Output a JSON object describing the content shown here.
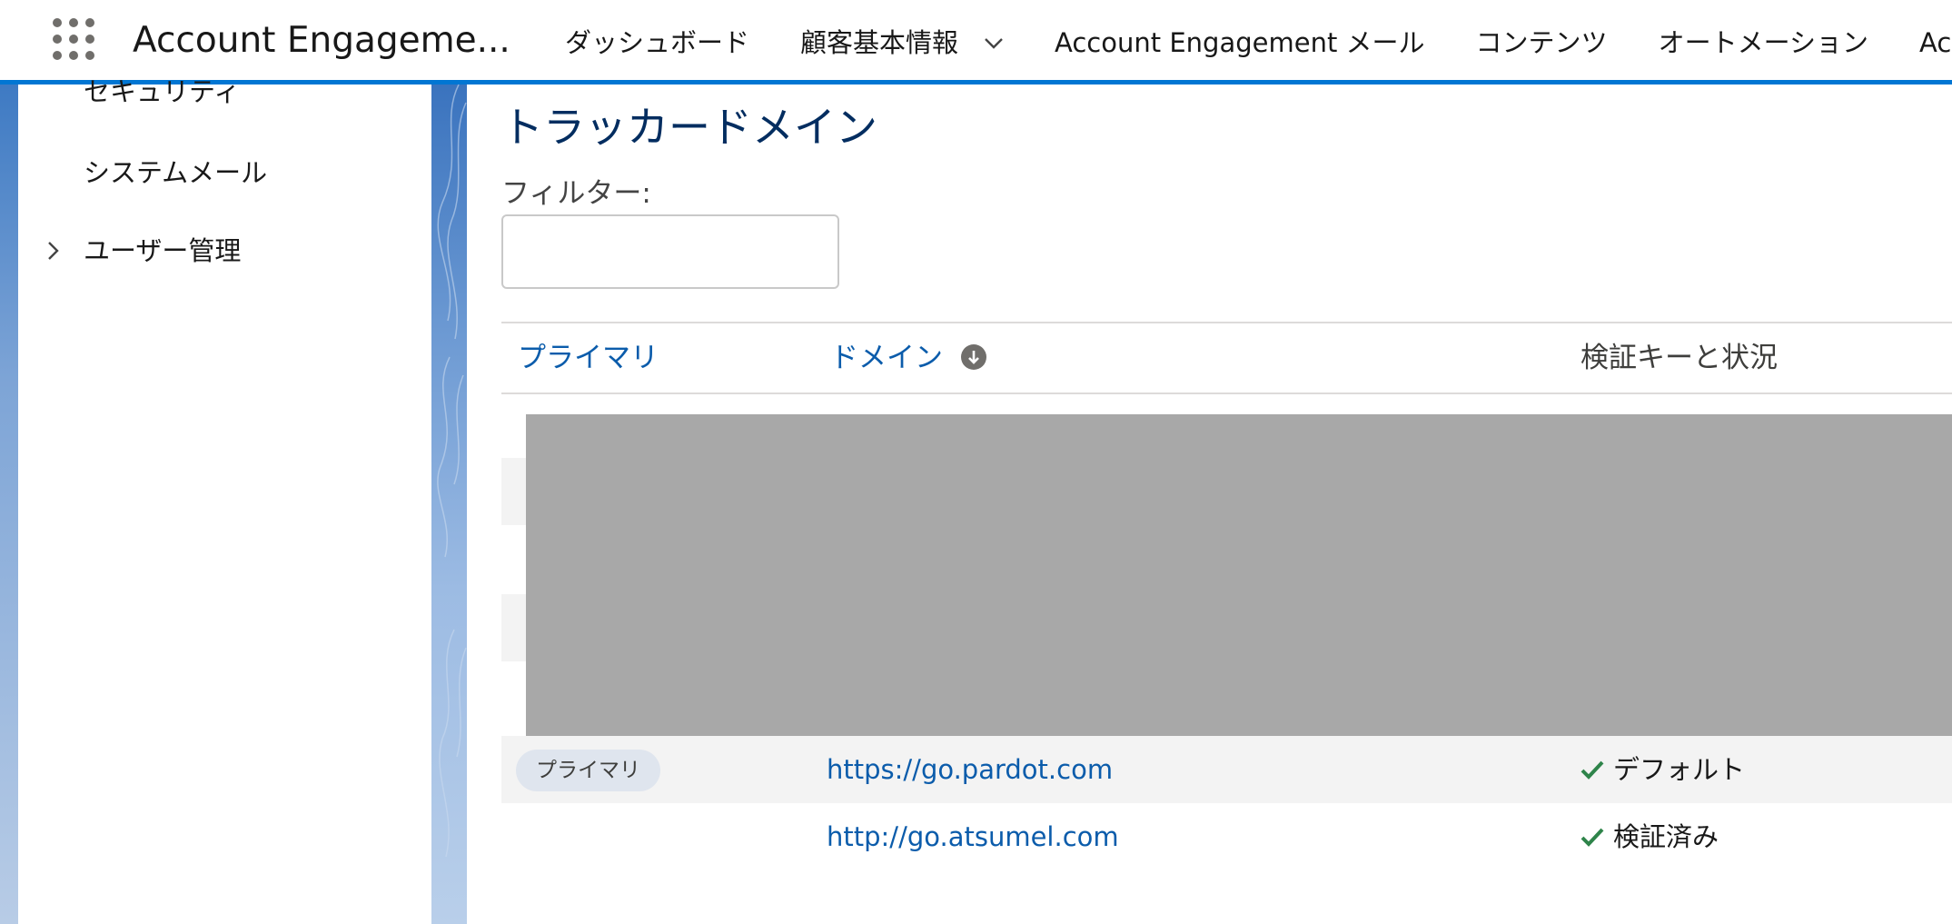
{
  "header": {
    "app_name": "Account Engageme...",
    "nav": [
      {
        "label": "ダッシュボード"
      },
      {
        "label": "顧客基本情報"
      },
      {
        "label": "Account Engagement メール"
      },
      {
        "label": "コンテンツ"
      },
      {
        "label": "オートメーション"
      },
      {
        "label": "Ac"
      }
    ]
  },
  "sidebar": {
    "items": [
      {
        "label": "セキュリティ"
      },
      {
        "label": "システムメール"
      },
      {
        "label": "ユーザー管理"
      }
    ]
  },
  "main": {
    "title": "トラッカードメイン",
    "filter": {
      "label": "フィルター:",
      "value": "",
      "placeholder": ""
    },
    "table": {
      "columns": [
        {
          "label": "プライマリ"
        },
        {
          "label": "ドメイン"
        },
        {
          "label": "検証キーと状況"
        }
      ],
      "rows": [
        {
          "badge": "プライマリ",
          "domain": "https://go.pardot.com",
          "status": "デフォルト"
        },
        {
          "badge": "",
          "domain": "http://go.atsumel.com",
          "status": "検証済み"
        }
      ]
    }
  },
  "colors": {
    "accent": "#0176d3",
    "link": "#0b5cab",
    "title": "#032d60",
    "check": "#2e844a",
    "redaction": "#a8a8a8"
  },
  "icons": [
    "app-launcher-icon",
    "chevron-down-icon",
    "chevron-right-icon",
    "sort-down-icon",
    "check-icon"
  ]
}
